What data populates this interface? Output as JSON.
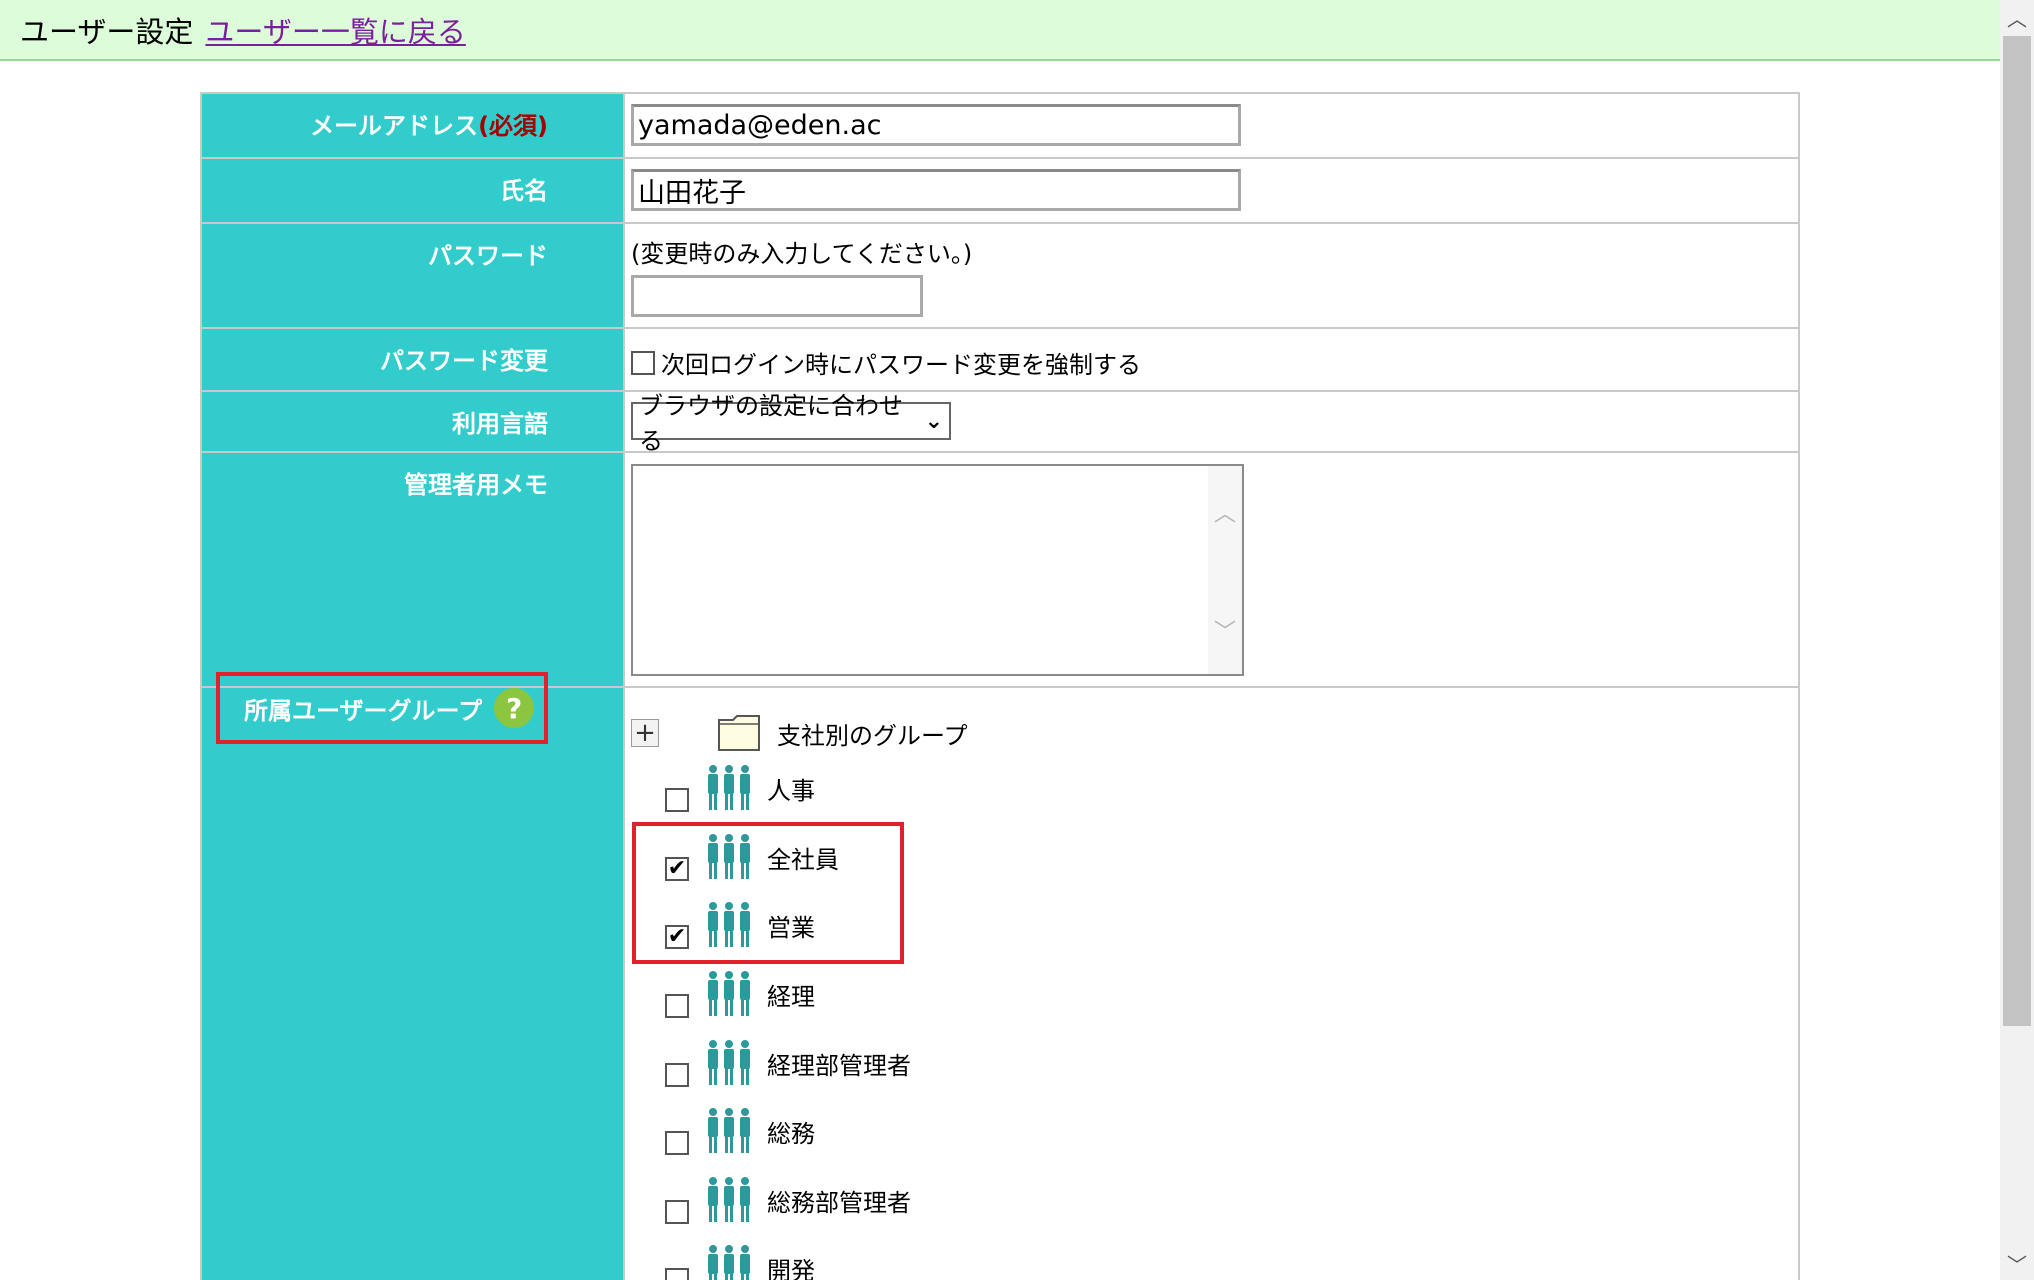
{
  "header": {
    "title": "ユーザー設定",
    "back_link": "ユーザー一覧に戻る"
  },
  "form": {
    "email": {
      "label": "メールアドレス",
      "required": "(必須)",
      "value": "yamada@eden.ac"
    },
    "name": {
      "label": "氏名",
      "value": "山田花子"
    },
    "password": {
      "label": "パスワード",
      "hint": "(変更時のみ入力してください。)",
      "value": ""
    },
    "password_change": {
      "label": "パスワード変更",
      "checkbox_label": "次回ログイン時にパスワード変更を強制する",
      "checked": false
    },
    "language": {
      "label": "利用言語",
      "selected": "ブラウザの設定に合わせる"
    },
    "admin_memo": {
      "label": "管理者用メモ",
      "value": ""
    },
    "groups": {
      "label": "所属ユーザーグループ",
      "help": "?",
      "root": "支社別のグループ",
      "items": [
        {
          "name": "人事",
          "checked": false,
          "mark": ""
        },
        {
          "name": "全社員",
          "checked": true,
          "mark": "✔"
        },
        {
          "name": "営業",
          "checked": true,
          "mark": "✔"
        },
        {
          "name": "経理",
          "checked": false,
          "mark": ""
        },
        {
          "name": "経理部管理者",
          "checked": false,
          "mark": ""
        },
        {
          "name": "総務",
          "checked": false,
          "mark": ""
        },
        {
          "name": "総務部管理者",
          "checked": false,
          "mark": ""
        },
        {
          "name": "開発",
          "checked": false,
          "mark": ""
        }
      ]
    }
  },
  "colors": {
    "header_bg": "#ddfcd9",
    "label_bg": "#33cccc",
    "highlight": "#e0202a",
    "people_icon": "#2a9a9a"
  }
}
